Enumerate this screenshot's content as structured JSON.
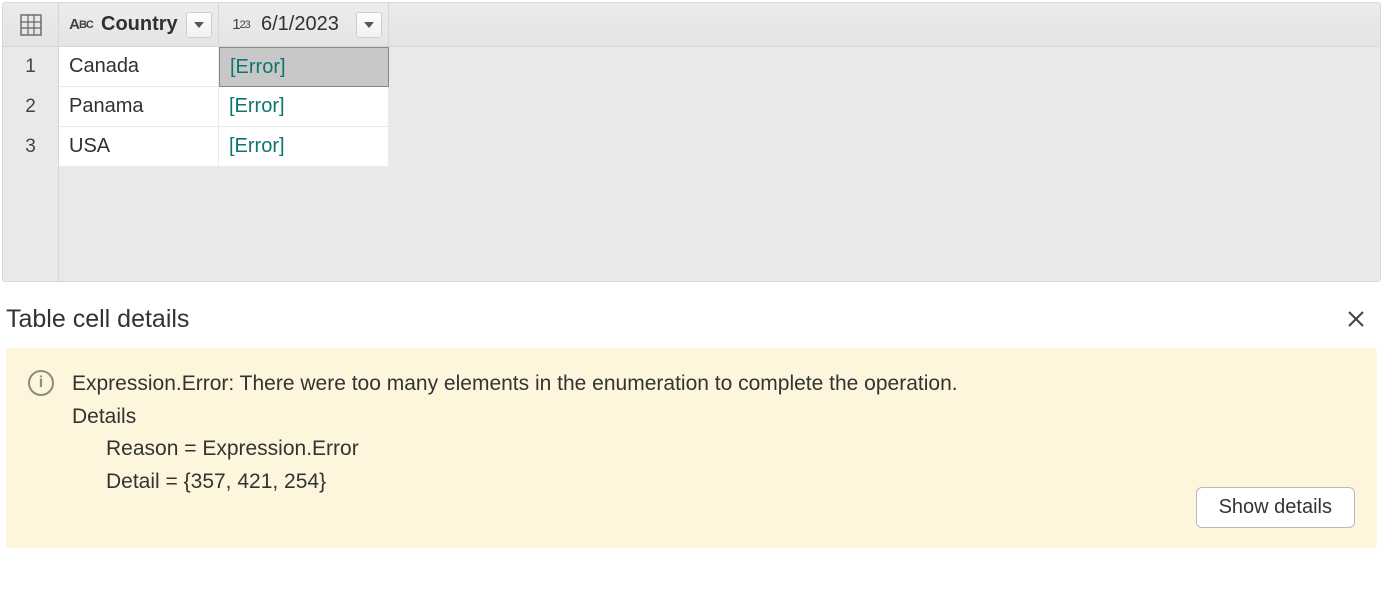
{
  "grid": {
    "columns": [
      {
        "type": "text",
        "label": "Country"
      },
      {
        "type": "number",
        "label": "6/1/2023"
      }
    ],
    "rows": [
      {
        "n": "1",
        "country": "Canada",
        "value": "[Error]",
        "selected": true
      },
      {
        "n": "2",
        "country": "Panama",
        "value": "[Error]",
        "selected": false
      },
      {
        "n": "3",
        "country": "USA",
        "value": "[Error]",
        "selected": false
      }
    ]
  },
  "details": {
    "panel_title": "Table cell details",
    "message": "Expression.Error: There were too many elements in the enumeration to complete the operation.",
    "details_label": "Details",
    "lines": [
      "Reason = Expression.Error",
      "Detail = {357, 421, 254}"
    ],
    "button_label": "Show details"
  }
}
